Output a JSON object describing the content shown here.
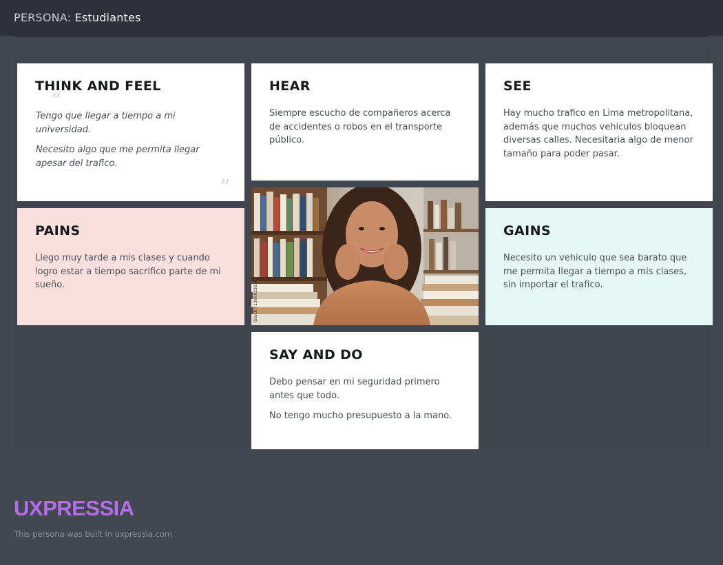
{
  "header": {
    "label": "PERSONA:",
    "name": "Estudiantes"
  },
  "think_and_feel": {
    "title": "THINK AND FEEL",
    "quotes": [
      "Tengo que llegar a tiempo a mi universidad.",
      "Necesito algo que me permita llegar apesar del trafico."
    ]
  },
  "hear": {
    "title": "HEAR",
    "text": "Siempre escucho de compañeros acerca de accidentes o robos en el transporte público."
  },
  "see": {
    "title": "SEE",
    "text": "Hay mucho trafico en Lima metropolitana, además que muchos vehiculos bloquean diversas calles. Necesitaria algo de menor tamaño para poder pasar."
  },
  "pains": {
    "title": "PAINS",
    "text": "Llego muy tarde a mis clases y cuando logro estar a tiempo sacrifico parte de mi sueño."
  },
  "gains": {
    "title": "GAINS",
    "text": "Necesito un vehiculo que sea barato que me permita llegar a tiempo a mis clases, sin importar el trafico."
  },
  "say_and_do": {
    "title": "SAY AND DO",
    "items": [
      "Debo pensar en mi seguridad primero antes que todo.",
      "No tengo mucho presupuesto a la mano."
    ]
  },
  "photo": {
    "watermark": "iStock | 1366923038"
  },
  "footer": {
    "logo": "UXPRESSIA",
    "credit": "This persona was built in uxpressia.com"
  },
  "colors": {
    "background": "#434750",
    "header": "#2e3139",
    "pains": "#f9dfdd",
    "gains": "#e6f8f5",
    "logo": "#b06ee8"
  }
}
